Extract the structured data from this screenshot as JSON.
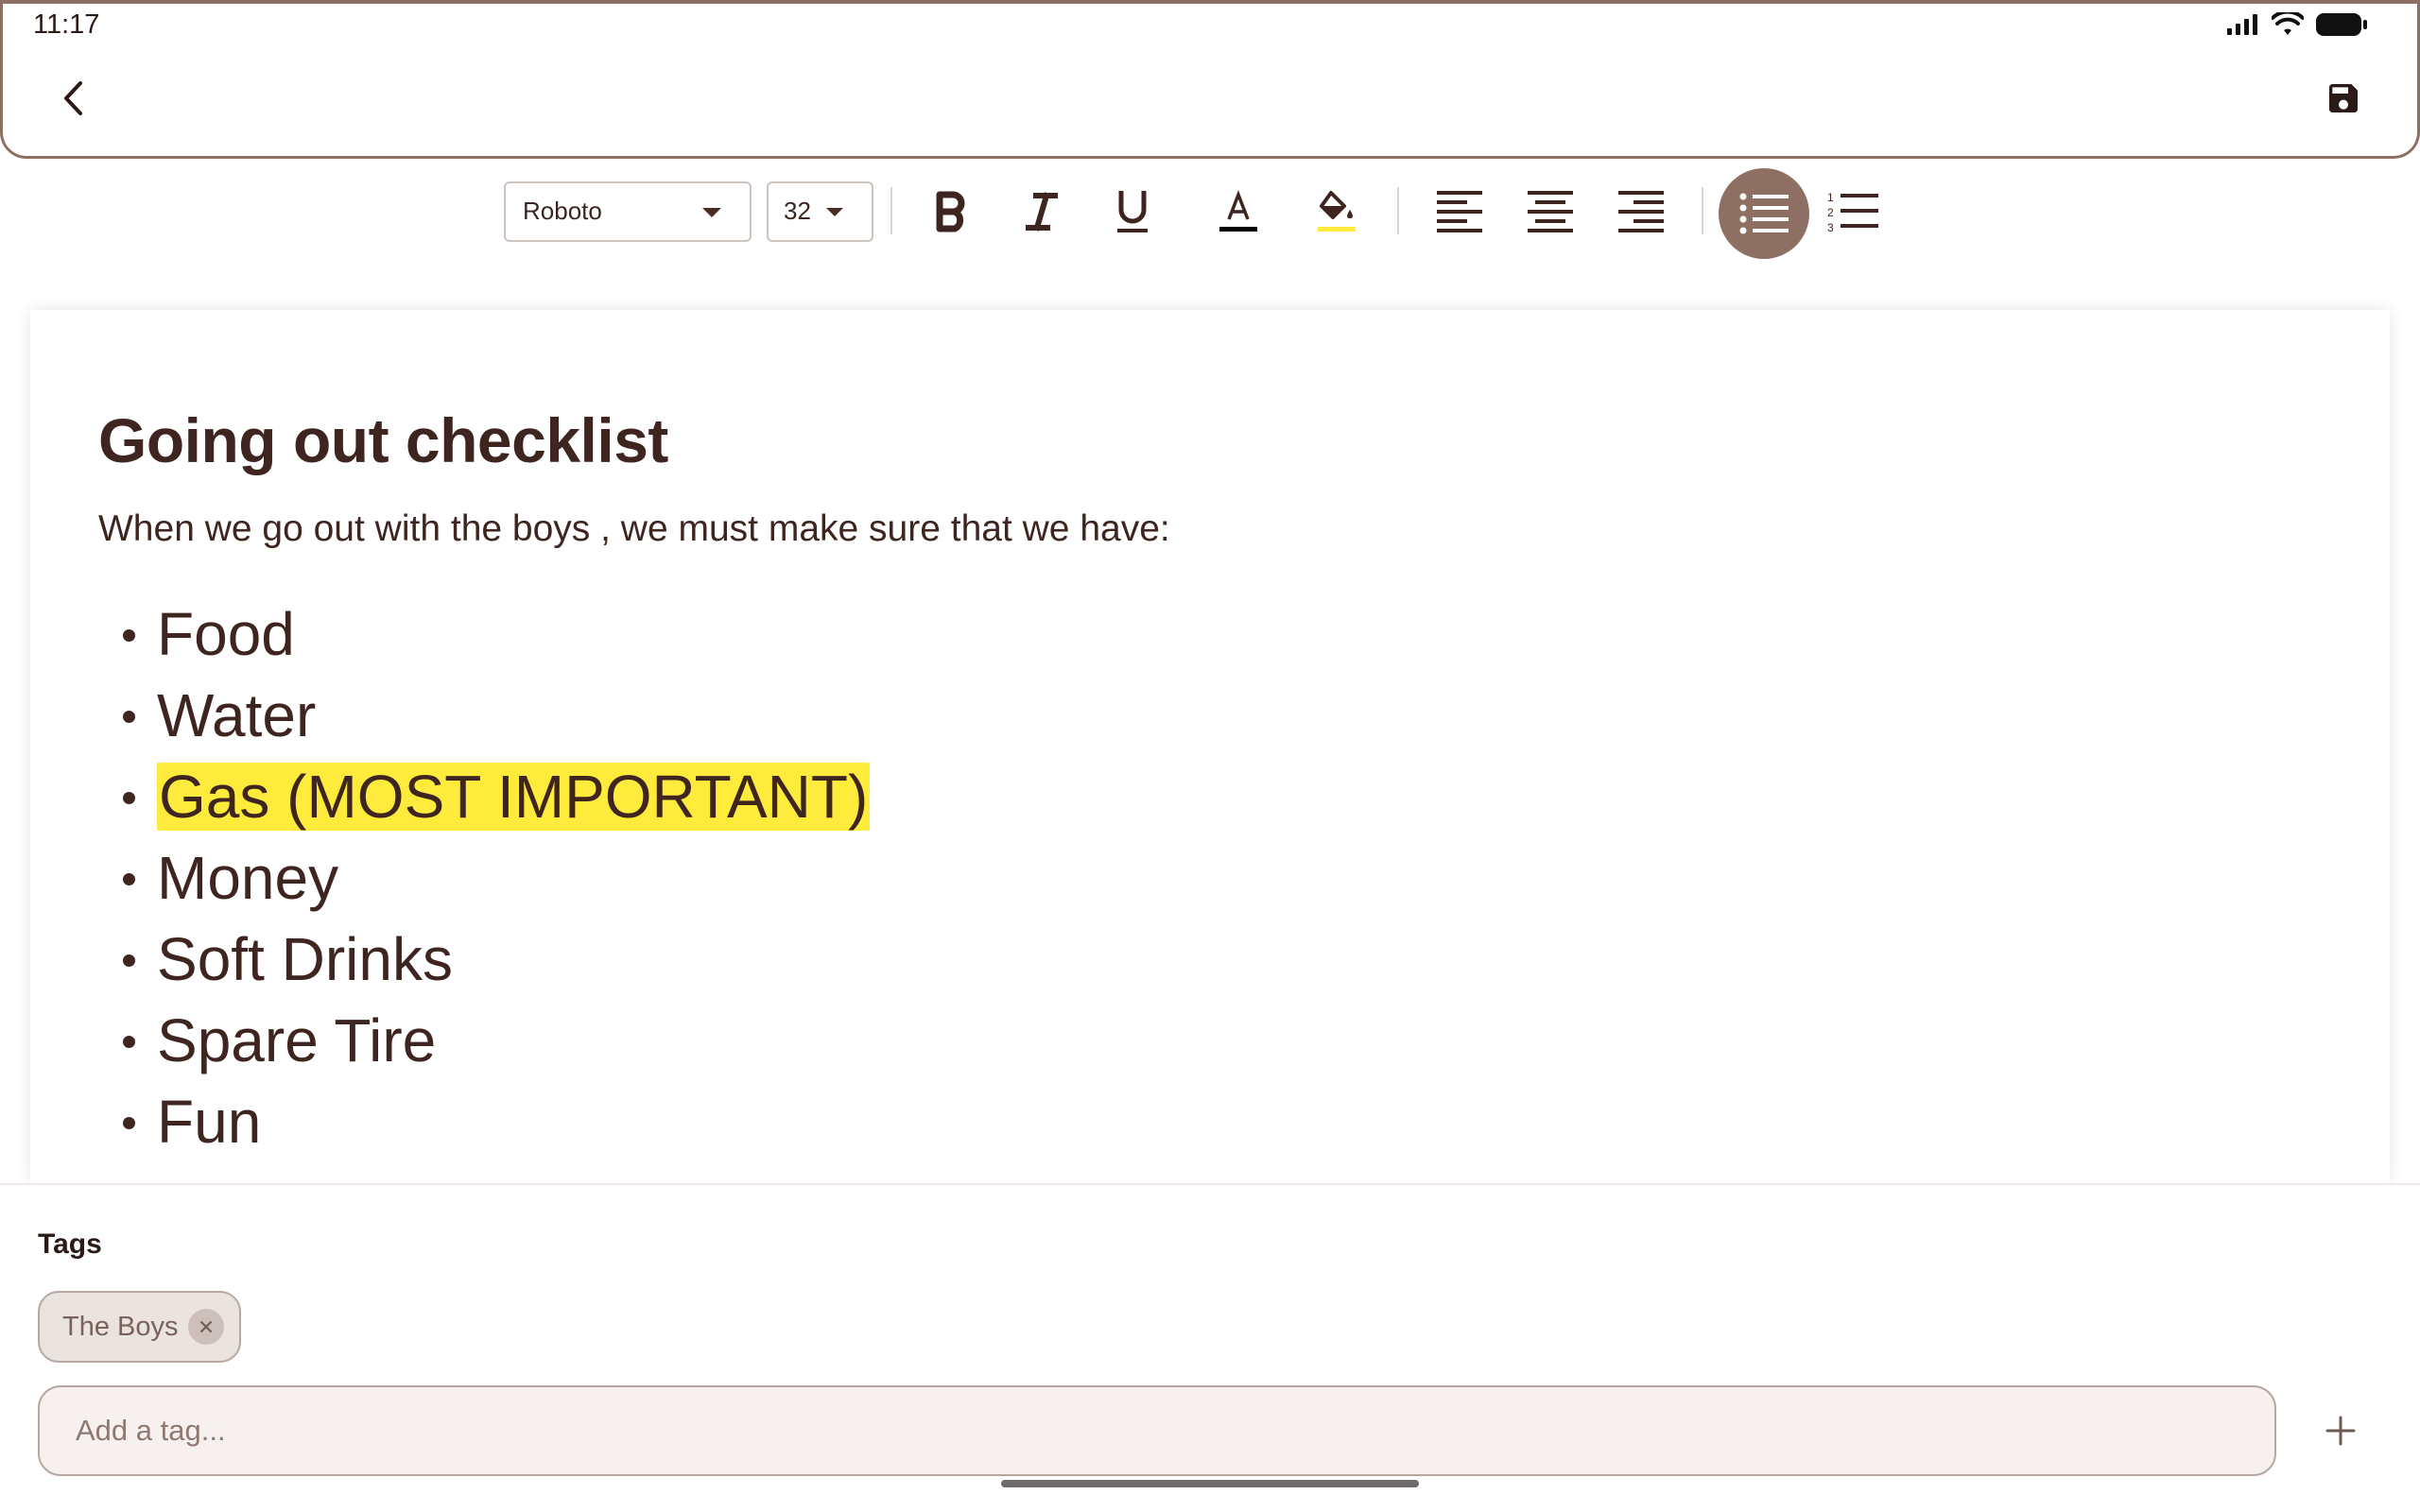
{
  "status_bar": {
    "time": "11:17",
    "icons": [
      "signal-icon",
      "wifi-icon",
      "battery-icon"
    ]
  },
  "app_bar": {
    "back_icon": "chevron-left-icon",
    "save_icon": "save-icon"
  },
  "toolbar": {
    "font_family": "Roboto",
    "font_size": "32",
    "buttons": [
      "bold-icon",
      "italic-icon",
      "underline-icon",
      "text-color-icon",
      "highlight-color-icon",
      "align-left-icon",
      "align-center-icon",
      "align-right-icon",
      "bullet-list-icon",
      "numbered-list-icon"
    ],
    "active_button": "bullet-list-icon",
    "text_color_underline": "#000000",
    "highlight_color_underline": "#ffeb3b"
  },
  "document": {
    "title": "Going out checklist",
    "intro": "When we go out with the boys , we must make sure that we have:",
    "items": [
      {
        "text": "Food"
      },
      {
        "text": "Water"
      },
      {
        "text": "Gas (MOST IMPORTANT)",
        "highlight": "#ffeb3b"
      },
      {
        "text": "Money"
      },
      {
        "text": "Soft Drinks"
      },
      {
        "text": "Spare Tire"
      },
      {
        "text": "Fun"
      }
    ]
  },
  "tags": {
    "label": "Tags",
    "chips": [
      {
        "label": "The Boys"
      }
    ],
    "input_placeholder": "Add a tag...",
    "input_value": "",
    "add_icon": "plus-icon"
  },
  "colors": {
    "accent": "#8e6f63",
    "text": "#3f2520",
    "highlight": "#ffeb3b"
  }
}
